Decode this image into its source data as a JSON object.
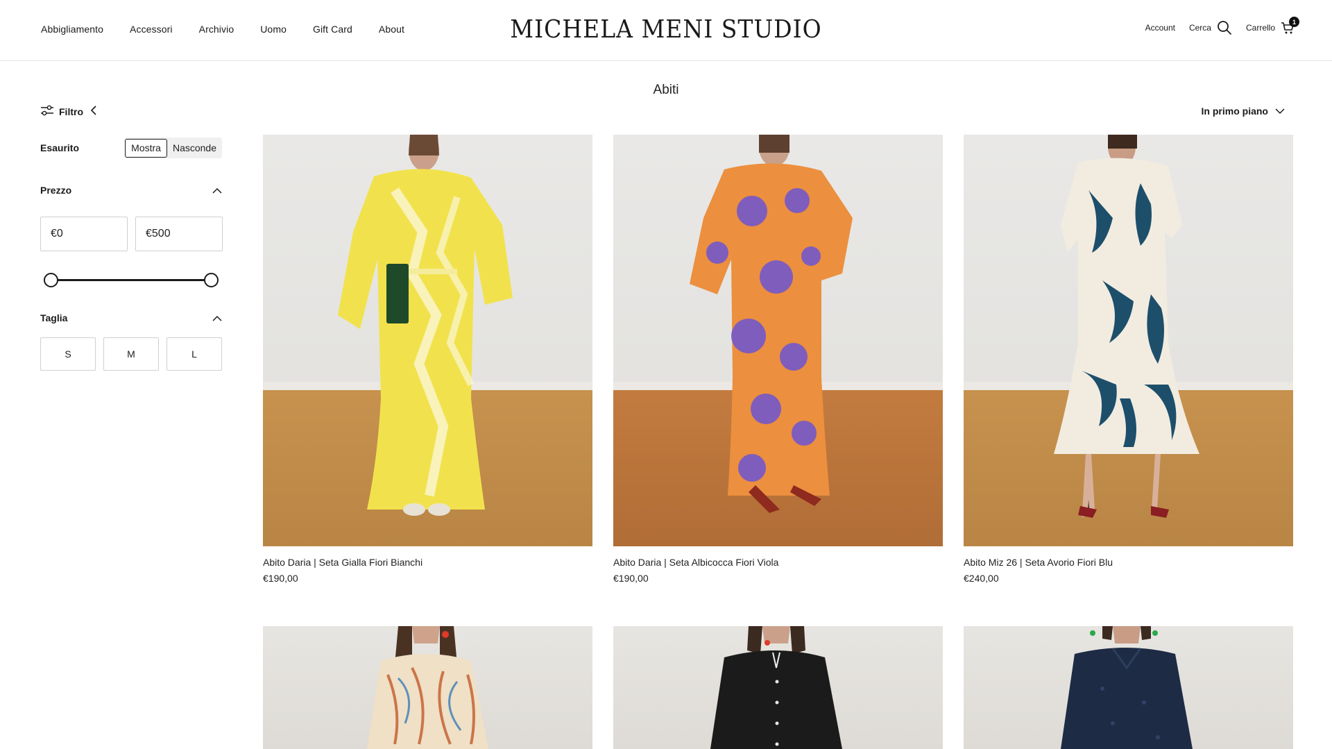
{
  "header": {
    "nav": [
      "Abbigliamento",
      "Accessori",
      "Archivio",
      "Uomo",
      "Gift Card",
      "About"
    ],
    "logo": "MICHELA MENI STUDIO",
    "account": "Account",
    "search": "Cerca",
    "cart": "Carrello",
    "cart_count": "1"
  },
  "page": {
    "title": "Abiti"
  },
  "filter": {
    "toggle_label": "Filtro",
    "stock_label": "Esaurito",
    "stock_options": [
      "Mostra",
      "Nasconde"
    ],
    "stock_selected": "Mostra",
    "price_label": "Prezzo",
    "price_min": "€0",
    "price_max": "€500",
    "size_label": "Taglia",
    "sizes": [
      "S",
      "M",
      "L"
    ]
  },
  "sort": {
    "label": "In primo piano"
  },
  "products": [
    {
      "title": "Abito Daria | Seta Gialla Fiori Bianchi",
      "price": "€190,00",
      "colors": {
        "dress": "#f1e24d",
        "pattern": "#fbf6d6"
      }
    },
    {
      "title": "Abito Daria | Seta Albicocca Fiori Viola",
      "price": "€190,00",
      "colors": {
        "dress": "#ec8f3e",
        "pattern": "#6c55d2"
      }
    },
    {
      "title": "Abito Miz 26 | Seta Avorio Fiori Blu",
      "price": "€240,00",
      "colors": {
        "dress": "#f2ece0",
        "pattern": "#1d4f6b"
      }
    },
    {
      "title": "",
      "price": "",
      "colors": {
        "dress": "#efe0c6",
        "pattern": "#c86a3c"
      }
    },
    {
      "title": "",
      "price": "",
      "colors": {
        "dress": "#1b1b1b",
        "pattern": "#1b1b1b"
      }
    },
    {
      "title": "",
      "price": "",
      "colors": {
        "dress": "#1e2b45",
        "pattern": "#1e2b45"
      }
    }
  ]
}
